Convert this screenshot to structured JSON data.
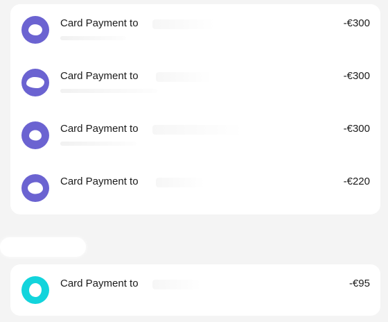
{
  "colors": {
    "background": "#f4f4f4",
    "card": "#ffffff",
    "avatar_purple": "#6b63d1",
    "avatar_teal": "#12d4dc",
    "text": "#1a1a1a"
  },
  "groups": [
    {
      "transactions": [
        {
          "title": "Card Payment to",
          "amount": "-€300",
          "icon": "merchant-avatar-icon"
        },
        {
          "title": "Card Payment to",
          "amount": "-€300",
          "icon": "merchant-avatar-icon"
        },
        {
          "title": "Card Payment to",
          "amount": "-€300",
          "icon": "merchant-avatar-icon"
        },
        {
          "title": "Card Payment to",
          "amount": "-€220",
          "icon": "merchant-avatar-icon"
        }
      ]
    },
    {
      "transactions": [
        {
          "title": "Card Payment to",
          "amount": "-€95",
          "icon": "merchant-avatar-icon"
        }
      ]
    }
  ]
}
